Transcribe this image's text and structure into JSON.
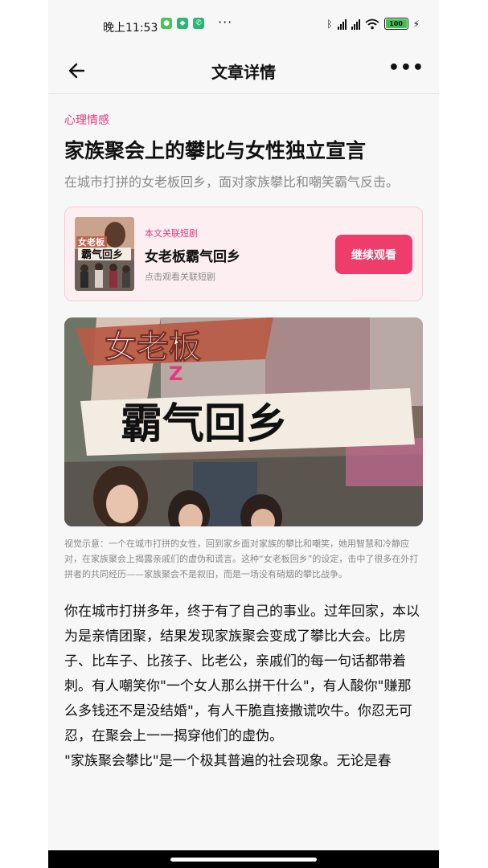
{
  "status_bar": {
    "time": "晚上11:53",
    "dots": "···",
    "battery": "100",
    "icons": [
      "wechat-icon",
      "shield-app-icon",
      "phone-app-icon",
      "bluetooth-icon",
      "signal-icon",
      "wifi-icon",
      "battery-icon",
      "charging-icon"
    ]
  },
  "nav": {
    "title": "文章详情",
    "more": "•••"
  },
  "article": {
    "category": "心理情感",
    "title": "家族聚会上的攀比与女性独立宣言",
    "subtitle": "在城市打拼的女老板回乡，面对家族攀比和嘲笑霸气反击。"
  },
  "drama_card": {
    "tag": "本文关联短剧",
    "name": "女老板霸气回乡",
    "hint": "点击观看关联短剧",
    "button": "继续观看",
    "poster_text": [
      "女老板",
      "霸气回乡"
    ]
  },
  "hero_image": {
    "lines": [
      "女老板",
      "Z",
      "霸气回乡"
    ]
  },
  "caption": "视觉示意：一个在城市打拼的女性，回到家乡面对家族的攀比和嘲笑，她用智慧和冷静应对，在家族聚会上揭露亲戚们的虚伪和谎言。这种“女老板回乡”的设定，击中了很多在外打拼者的共同经历——家族聚会不是叙旧，而是一场没有硝烟的攀比战争。",
  "body": [
    "你在城市打拼多年，终于有了自己的事业。过年回家，本以为是亲情团聚，结果发现家族聚会变成了攀比大会。比房子、比车子、比孩子、比老公，亲戚们的每一句话都带着刺。有人嘲笑你\"一个女人那么拼干什么\"，有人酸你\"赚那么多钱还不是没结婚\"，有人干脆直接撒谎吹牛。你忍无可忍，在聚会上一一揭穿他们的虚伪。",
    "\"家族聚会攀比\"是一个极其普遍的社会现象。无论是春"
  ],
  "colors": {
    "accent": "#e5397a",
    "button": "#ee3d6a",
    "card_bg": "#fdeef2"
  }
}
